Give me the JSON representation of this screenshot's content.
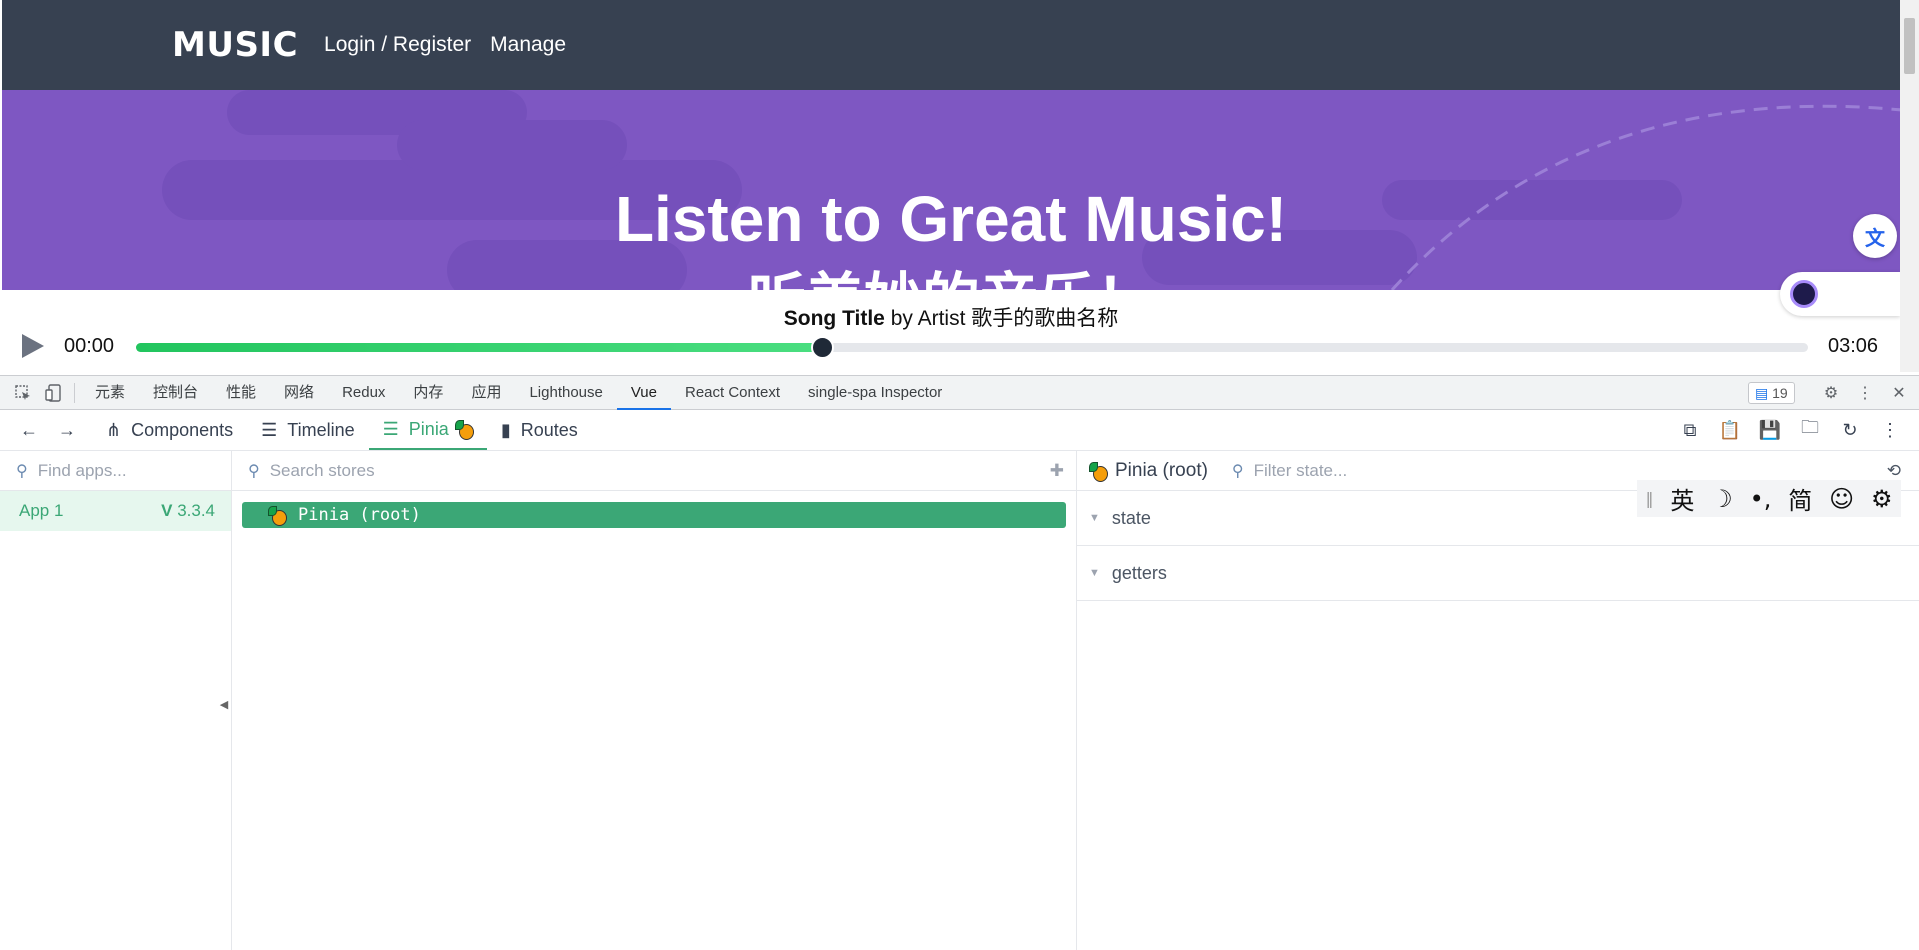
{
  "header": {
    "logo": "MUSIC",
    "nav": [
      "Login / Register",
      "Manage"
    ]
  },
  "hero": {
    "title": "Listen to Great Music!",
    "subtitle": "听美妙的音乐！"
  },
  "player": {
    "song_title": "Song Title",
    "song_by": " by Artist 歌手的歌曲名称",
    "current_time": "00:00",
    "total_time": "03:06",
    "progress": 0.41
  },
  "devtools": {
    "tabs": [
      "元素",
      "控制台",
      "性能",
      "网络",
      "Redux",
      "内存",
      "应用",
      "Lighthouse",
      "Vue",
      "React Context",
      "single-spa Inspector"
    ],
    "active_tab": "Vue",
    "messages_count": "19"
  },
  "vue_toolbar": {
    "components": "Components",
    "timeline": "Timeline",
    "pinia": "Pinia",
    "routes": "Routes"
  },
  "apps_pane": {
    "search_placeholder": "Find apps...",
    "app_name": "App 1",
    "vue_version": "3.3.4"
  },
  "stores_pane": {
    "search_placeholder": "Search stores",
    "store_root": "Pinia (root)"
  },
  "state_pane": {
    "title": "Pinia (root)",
    "filter_placeholder": "Filter state...",
    "sections": [
      "state",
      "getters"
    ]
  },
  "ime": {
    "lang": "英",
    "mode": "简"
  },
  "colors": {
    "header_bg": "#374151",
    "hero_bg": "#7e57c2",
    "vue_green": "#3ba776",
    "progress": "#22c55e"
  }
}
